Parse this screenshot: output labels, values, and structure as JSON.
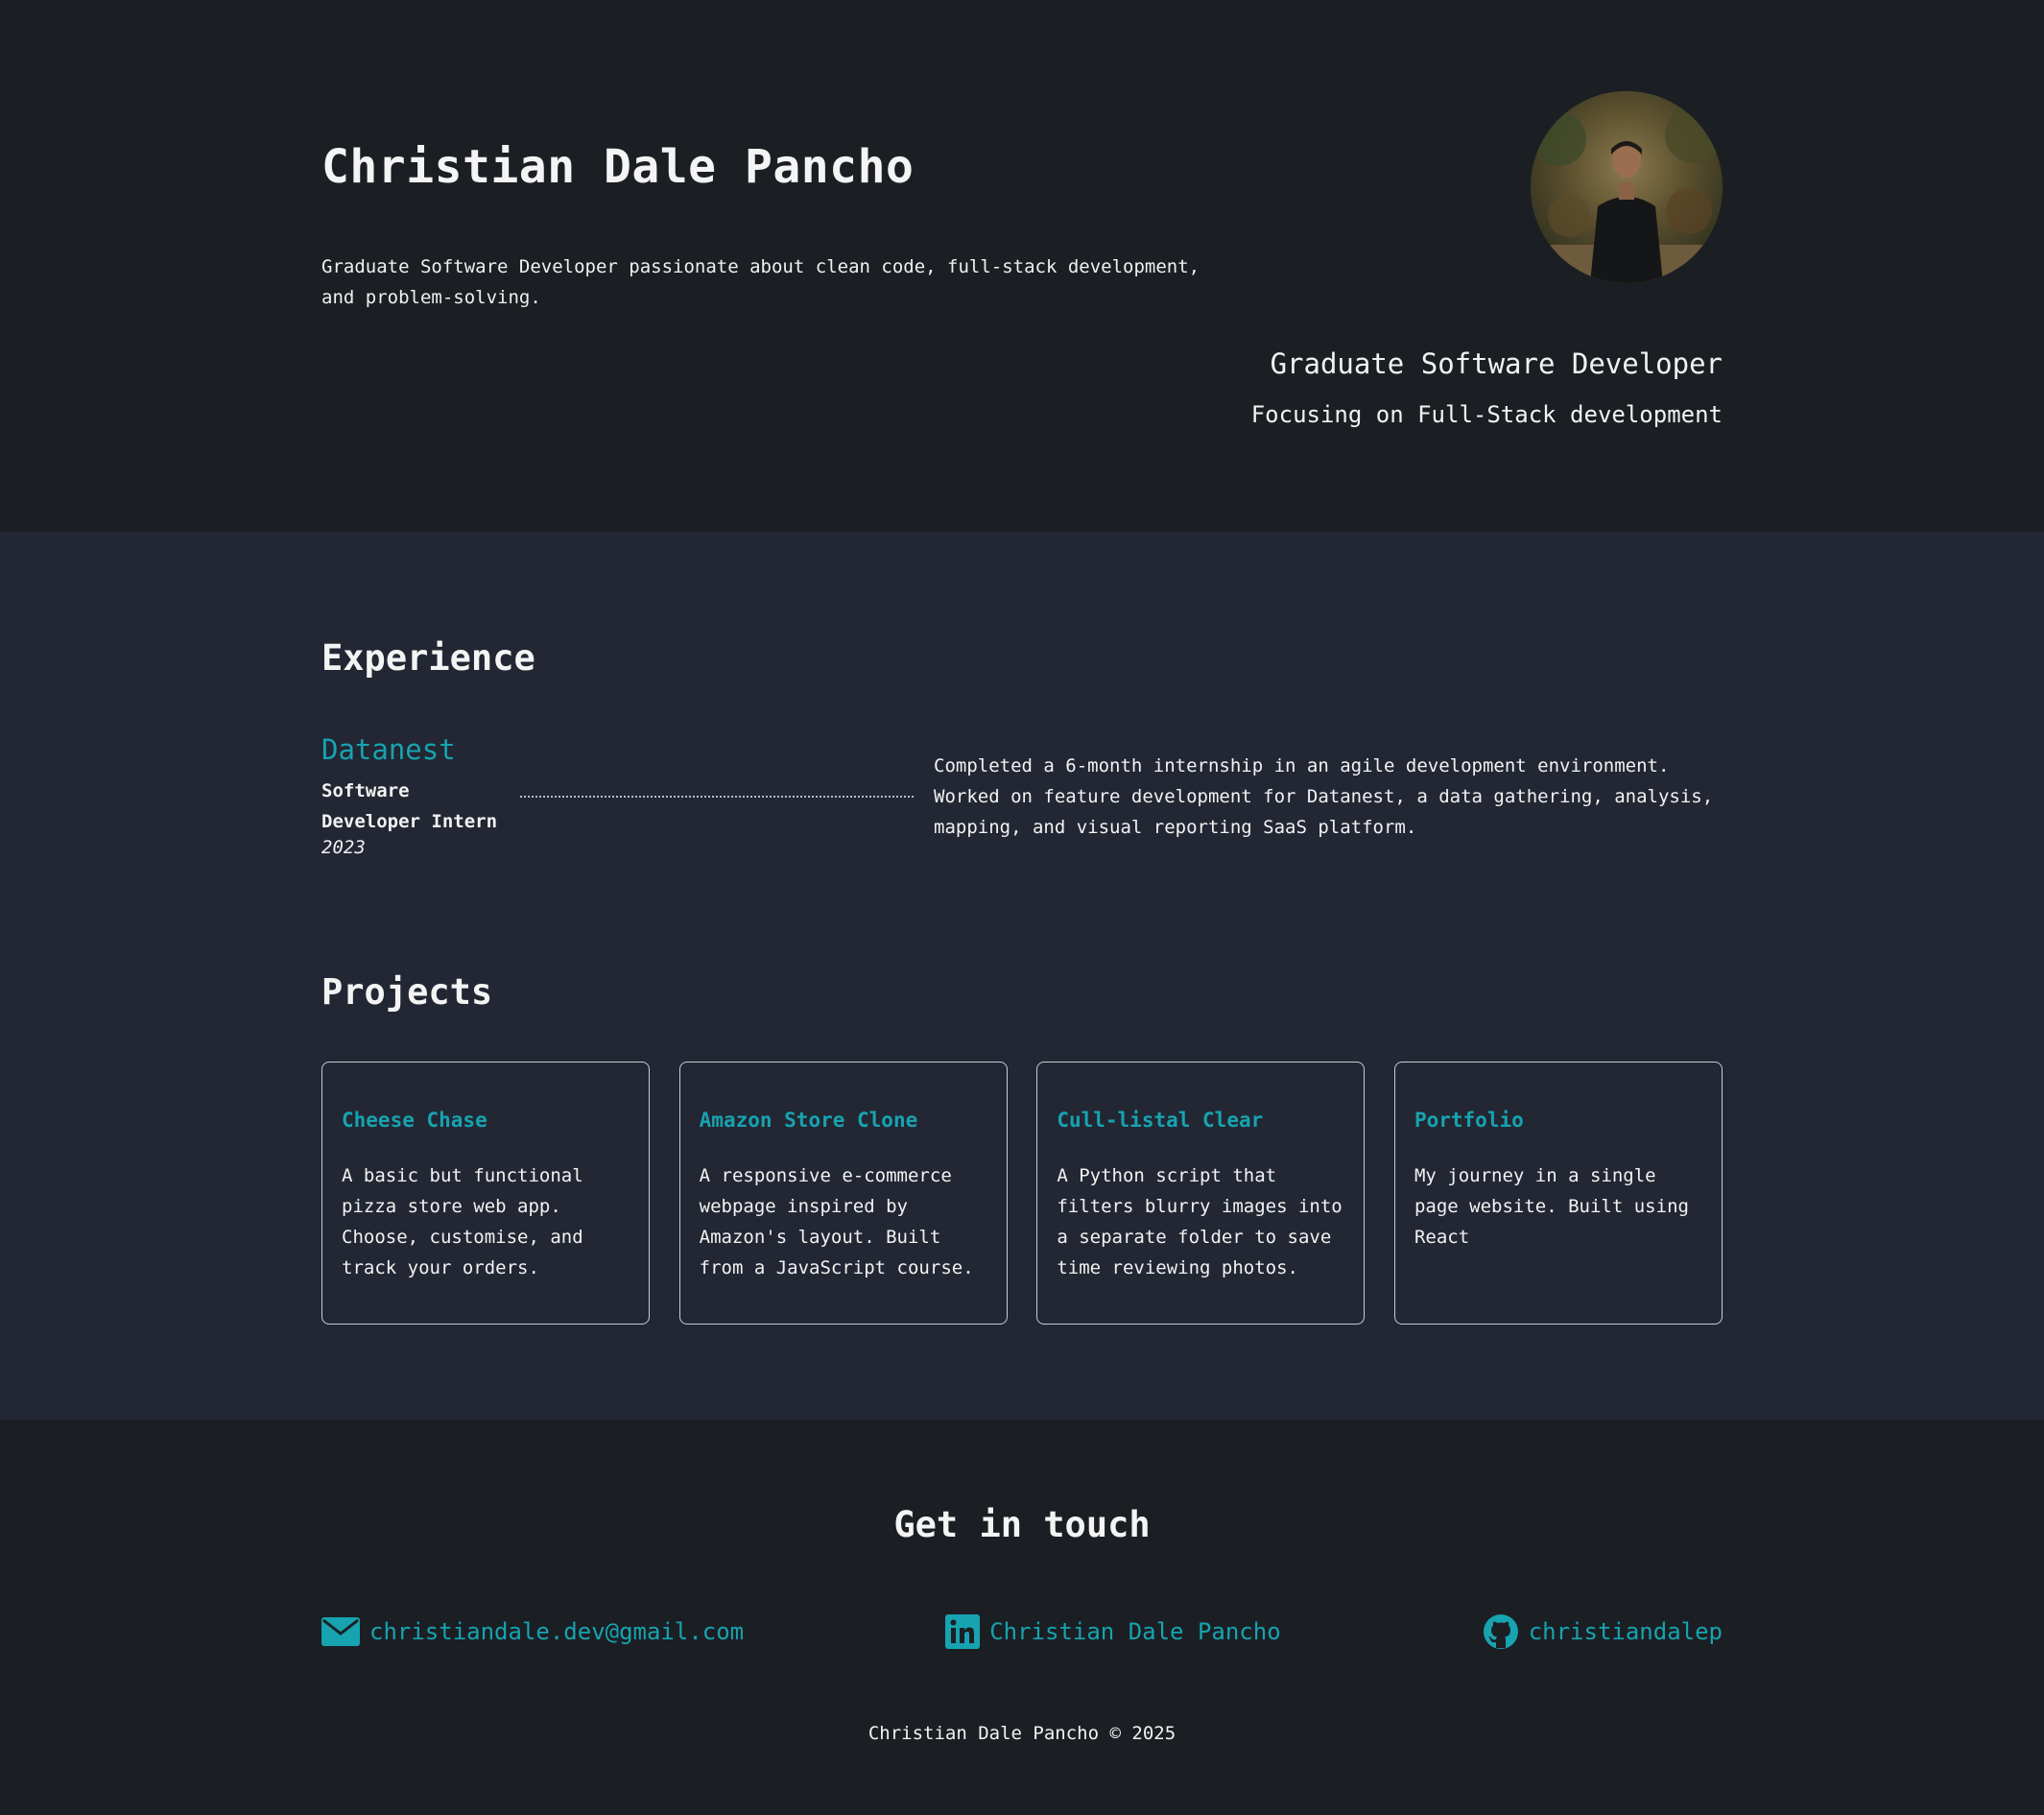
{
  "hero": {
    "name": "Christian Dale Pancho",
    "bio": "Graduate Software Developer passionate about clean code, full-stack development, and problem-solving.",
    "role": "Graduate Software Developer",
    "focus": "Focusing on Full-Stack development",
    "avatar_icon": "profile-photo"
  },
  "experience": {
    "heading": "Experience",
    "items": [
      {
        "company": "Datanest",
        "role": "Software Developer Intern",
        "year": "2023",
        "description": "Completed a 6-month internship in an agile development environment. Worked on feature development for Datanest, a data gathering, analysis, mapping, and visual reporting SaaS platform."
      }
    ]
  },
  "projects": {
    "heading": "Projects",
    "items": [
      {
        "title": "Cheese Chase",
        "description": "A basic but functional pizza store web app. Choose, customise, and track your orders."
      },
      {
        "title": "Amazon Store Clone",
        "description": "A responsive e-commerce webpage inspired by Amazon's layout. Built from a JavaScript course."
      },
      {
        "title": "Cull-listal Clear",
        "description": "A Python script that filters blurry images into a separate folder to save time reviewing photos."
      },
      {
        "title": "Portfolio",
        "description": "My journey in a single page website. Built using React"
      }
    ]
  },
  "contact": {
    "heading": "Get in touch",
    "email": {
      "label": "christiandale.dev@gmail.com",
      "icon": "envelope-icon"
    },
    "linkedin": {
      "label": "Christian Dale Pancho",
      "icon": "linkedin-icon"
    },
    "github": {
      "label": "christiandalep",
      "icon": "github-icon"
    }
  },
  "footer": {
    "copyright": "Christian Dale Pancho © 2025"
  },
  "colors": {
    "background": "#1b1f24",
    "section_background": "#222733",
    "accent": "#17a3b0",
    "text": "#f2f2f2"
  }
}
